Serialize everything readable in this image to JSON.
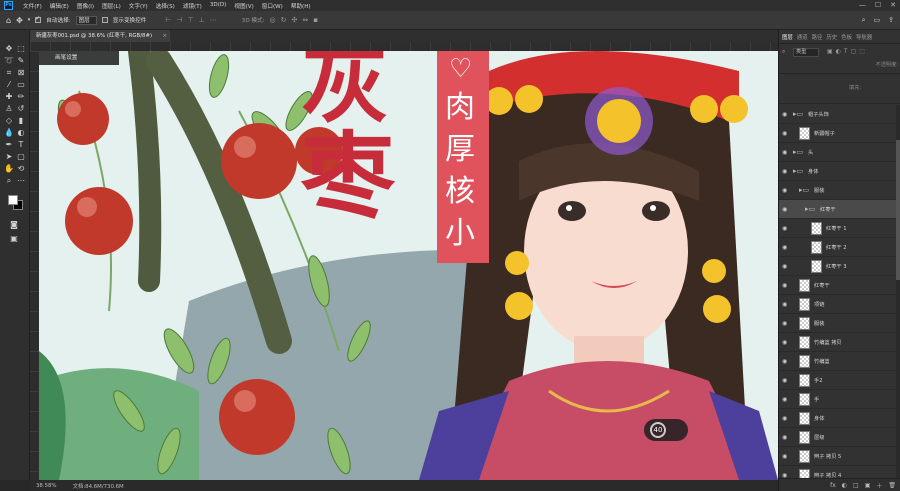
{
  "menubar": {
    "logo": "Ps",
    "items": [
      "文件(F)",
      "编辑(E)",
      "图像(I)",
      "图层(L)",
      "文字(Y)",
      "选择(S)",
      "滤镜(T)",
      "3D(D)",
      "视图(V)",
      "窗口(W)",
      "帮助(H)"
    ],
    "window_controls": [
      "—",
      "☐",
      "✕"
    ]
  },
  "options": {
    "auto_select_label": "自动选择:",
    "auto_select_value": "图层",
    "show_transform_label": "显示变换控件",
    "threed_mode": "3D 模式:"
  },
  "tab": {
    "title": "新疆灰枣001.psd @ 38.6% (红枣干, RGB/8#)",
    "close": "×"
  },
  "canvas": {
    "overlay_label": "画笔设置",
    "title_chars": [
      "灰",
      "枣"
    ],
    "subtitle_heart": "♡",
    "subtitle_chars": [
      "肉",
      "厚",
      "核",
      "小"
    ],
    "zoom_hud": "40"
  },
  "statusbar": {
    "zoom": "38.58%",
    "doc_size": "文档:84.6M/730.6M"
  },
  "layers_panel": {
    "tabs": [
      "图层",
      "通道",
      "路径",
      "历史",
      "色板",
      "导航器"
    ],
    "filter": "类型",
    "opacity_label": "不透明度:",
    "fill_label": "填充:",
    "layers": [
      {
        "name": "帽子头饰",
        "kind": "folder",
        "indent": 0
      },
      {
        "name": "新疆帽子",
        "kind": "layer",
        "indent": 1
      },
      {
        "name": "头",
        "kind": "folder",
        "indent": 0
      },
      {
        "name": "身体",
        "kind": "folder",
        "indent": 0
      },
      {
        "name": "服装",
        "kind": "folder",
        "indent": 1
      },
      {
        "name": "红枣干",
        "kind": "folder",
        "indent": 2,
        "selected": true
      },
      {
        "name": "红枣干 1",
        "kind": "layer",
        "indent": 3
      },
      {
        "name": "红枣干 2",
        "kind": "layer",
        "indent": 3
      },
      {
        "name": "红枣干 3",
        "kind": "layer",
        "indent": 3
      },
      {
        "name": "红枣干",
        "kind": "layer",
        "indent": 1
      },
      {
        "name": "项链",
        "kind": "layer",
        "indent": 1
      },
      {
        "name": "服装",
        "kind": "layer",
        "indent": 1
      },
      {
        "name": "竹编篮 拷贝",
        "kind": "layer",
        "indent": 1
      },
      {
        "name": "竹编篮",
        "kind": "layer",
        "indent": 1
      },
      {
        "name": "手2",
        "kind": "layer",
        "indent": 1
      },
      {
        "name": "手",
        "kind": "layer",
        "indent": 1
      },
      {
        "name": "身体",
        "kind": "layer",
        "indent": 1
      },
      {
        "name": "层级",
        "kind": "layer",
        "indent": 1
      },
      {
        "name": "辫子 拷贝 5",
        "kind": "layer",
        "indent": 1
      },
      {
        "name": "辫子 拷贝 4",
        "kind": "layer",
        "indent": 1
      }
    ],
    "footer_icons": [
      "fx",
      "◐",
      "□",
      "▣",
      "＋",
      "🗑"
    ]
  },
  "colors": {
    "title_red": "#c72c3a",
    "banner_pink": "#e0535d",
    "ps_blue": "#31a8ff"
  }
}
